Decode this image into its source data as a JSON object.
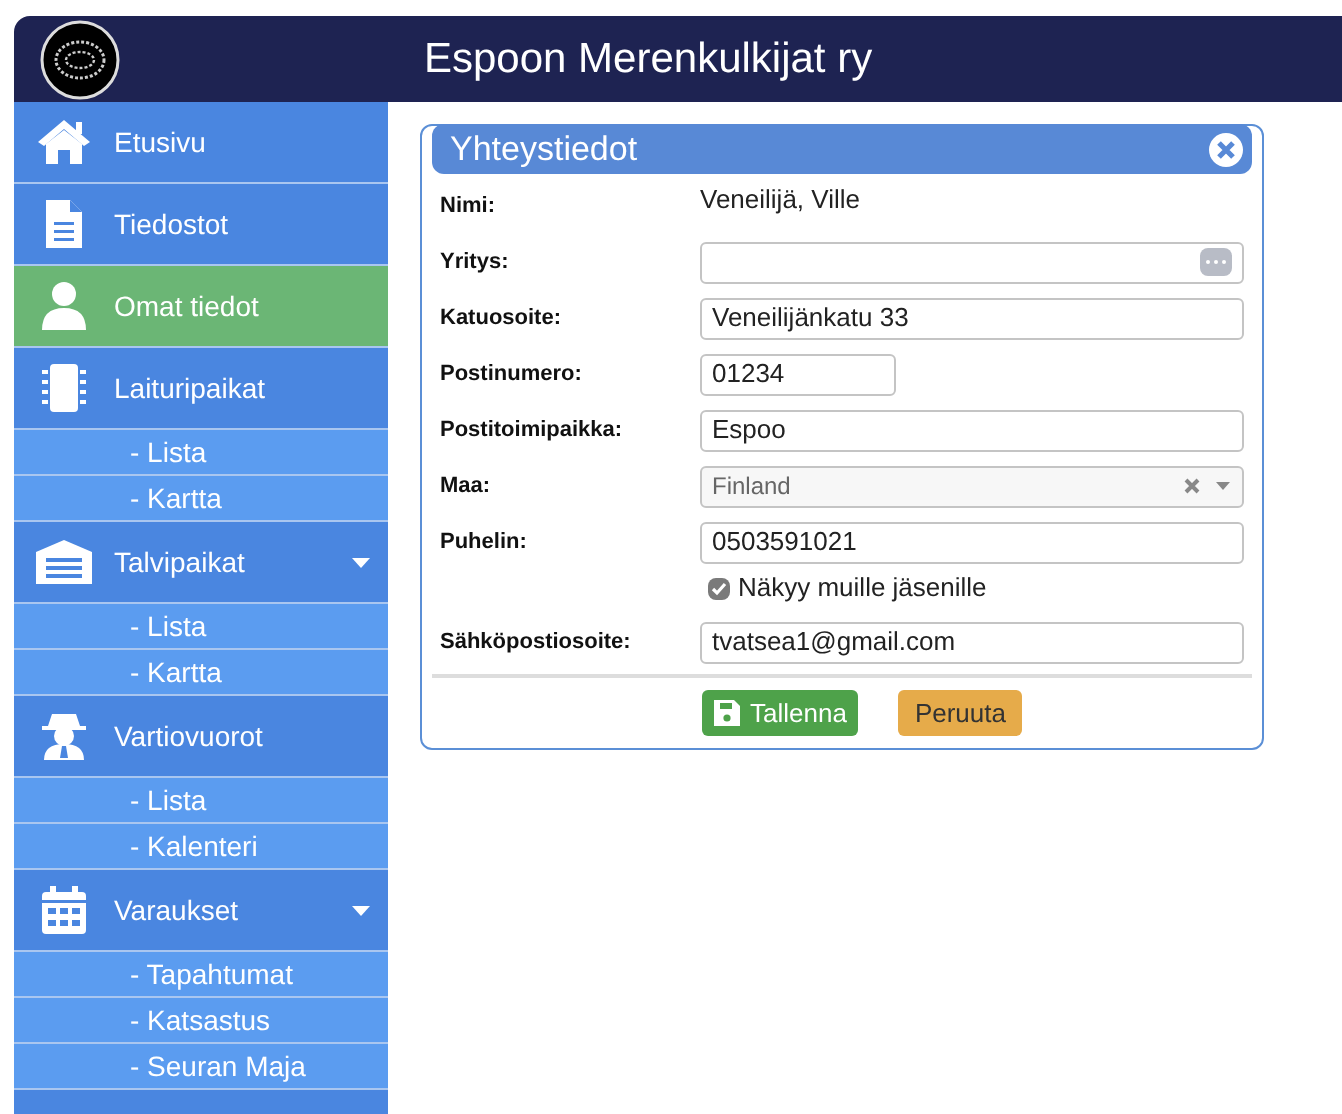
{
  "header": {
    "title": "Espoon Merenkulkijat ry"
  },
  "sidebar": {
    "items": [
      {
        "label": "Etusivu",
        "selected": false
      },
      {
        "label": "Tiedostot",
        "selected": false
      },
      {
        "label": "Omat tiedot",
        "selected": true
      },
      {
        "label": "Laituripaikat",
        "selected": false,
        "children": [
          {
            "label": "- Lista"
          },
          {
            "label": "- Kartta"
          }
        ]
      },
      {
        "label": "Talvipaikat",
        "selected": false,
        "expanded": true,
        "children": [
          {
            "label": "- Lista"
          },
          {
            "label": "- Kartta"
          }
        ]
      },
      {
        "label": "Vartiovuorot",
        "selected": false,
        "children": [
          {
            "label": "- Lista"
          },
          {
            "label": "- Kalenteri"
          }
        ]
      },
      {
        "label": "Varaukset",
        "selected": false,
        "expanded": true,
        "children": [
          {
            "label": "- Tapahtumat"
          },
          {
            "label": "- Katsastus"
          },
          {
            "label": "- Seuran Maja"
          }
        ]
      }
    ]
  },
  "dialog": {
    "title": "Yhteystiedot",
    "fields": [
      {
        "kind": "static",
        "label": "Nimi:",
        "value": "Veneilijä, Ville"
      },
      {
        "kind": "lookup",
        "label": "Yritys:"
      },
      {
        "kind": "text",
        "label": "Katuosoite:",
        "value": "Veneilijänkatu 33"
      },
      {
        "kind": "short",
        "label": "Postinumero:",
        "value": "01234"
      },
      {
        "kind": "text",
        "label": "Postitoimipaikka:",
        "value": "Espoo"
      },
      {
        "kind": "select",
        "label": "Maa:",
        "value": "Finland"
      },
      {
        "kind": "text",
        "label": "Puhelin:",
        "value": "0503591021"
      },
      {
        "kind": "checkbox",
        "label": "Näkyy muille jäsenille",
        "checked": true
      },
      {
        "kind": "text",
        "label": "Sähköpostiosoite:",
        "value": "tvatsea1@gmail.com"
      }
    ],
    "buttons": [
      {
        "kind": "save",
        "label": "Tallenna"
      },
      {
        "kind": "cancel",
        "label": "Peruuta"
      }
    ]
  }
}
